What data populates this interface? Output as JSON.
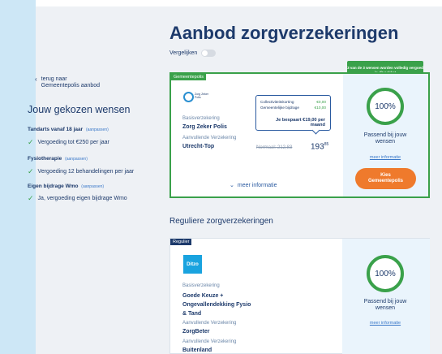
{
  "back_link": {
    "line1": "terug naar",
    "line2": "Gemeentepolis aanbod"
  },
  "wishes": {
    "title": "Jouw gekozen wensen",
    "edit_label": "(aanpassen)",
    "groups": [
      {
        "heading": "Tandarts vanaf 18 jaar",
        "items": [
          "Vergoeding tot €250 per jaar"
        ]
      },
      {
        "heading": "Fysiotherapie",
        "items": [
          "Vergoeding 12 behandelingen per jaar"
        ]
      },
      {
        "heading": "Eigen bijdrage Wmo",
        "items": [
          "Ja, vergoeding eigen bijdrage Wmo"
        ]
      }
    ]
  },
  "page_title": "Aanbod zorgverzekeringen",
  "compare_label": "Vergelijken",
  "card1": {
    "tag": "Gemeentepolis",
    "tooltip": "3 van de 3 wensen worden volledig vergoed in dit pakket",
    "logo_text": [
      "Zorg",
      "Zeker",
      "Polis"
    ],
    "basis_label": "Basisverzekering",
    "basis_value": "Zorg Zeker Polis",
    "aanv_label": "Aanvullende Verzekering",
    "aanv_value": "Utrecht-Top",
    "collectief_label": "Collectiviteitskorting",
    "collectief_value": "€0,00",
    "gemeente_label": "Gemeentelijke bijdrage",
    "gemeente_value": "€10,00",
    "save_line1": "Je bespaart €19,00 per",
    "save_line2": "maand",
    "price_old": "Normaal: 212,83",
    "price_main": "193",
    "price_cents": "85",
    "meer_info": "meer informatie",
    "percentage": "100%",
    "passend": "Passend bij jouw wensen",
    "meer_link": "meer informatie",
    "kies_line1": "Kies",
    "kies_line2": "Gemeentepolis"
  },
  "section_title": "Reguliere zorgverzekeringen",
  "card2": {
    "tag": "Regulier",
    "logo": "Ditzo",
    "basis_label": "Basisverzekering",
    "basis_value_lines": [
      "Goede Keuze +",
      "Ongevallendekking Fysio",
      "& Tand"
    ],
    "aanv_label": "Aanvullende Verzekering",
    "aanv_value": "ZorgBeter",
    "aanv2_label": "Aanvullende Verzekering",
    "aanv2_value": "Buitenland",
    "percentage": "100%",
    "passend": "Passend bij jouw wensen",
    "meer_link": "meer informatie"
  },
  "colors": {
    "green": "#3aa14a",
    "navy": "#1d3a6b",
    "orange": "#ef7a2c",
    "light_blue": "#eaf4fc"
  }
}
